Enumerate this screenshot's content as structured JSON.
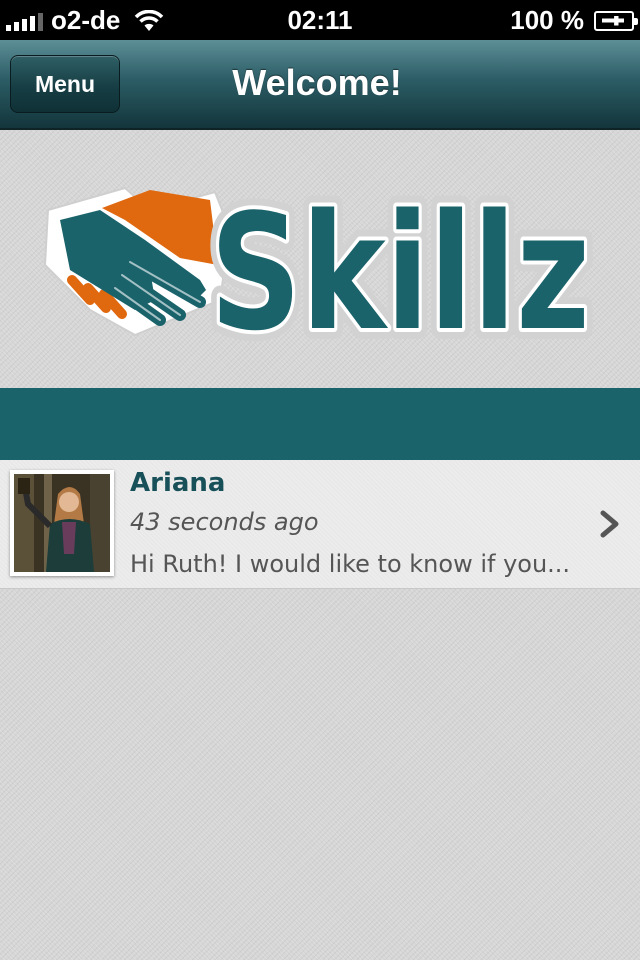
{
  "status_bar": {
    "carrier": "o2-de",
    "time": "02:11",
    "battery": "100 %"
  },
  "nav": {
    "menu_label": "Menu",
    "title": "Welcome!"
  },
  "logo": {
    "text": "Skillz"
  },
  "messages": [
    {
      "name": "Ariana",
      "time": "43 seconds ago",
      "preview": "Hi Ruth! I would like to know if you..."
    }
  ],
  "colors": {
    "teal": "#1a636b",
    "orange": "#e0680f",
    "name_text": "#18505a"
  }
}
